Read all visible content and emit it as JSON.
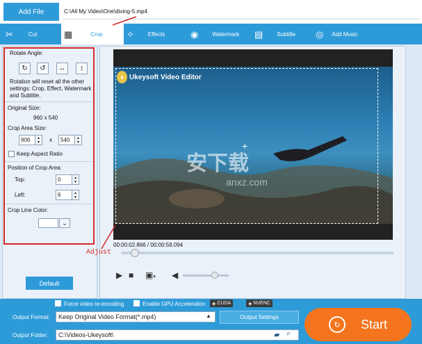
{
  "topbar": {
    "add_file": "Add File",
    "file_path": "C:\\All My Video\\One\\diving-5.mp4"
  },
  "tabs": [
    {
      "label": "Cut",
      "icon": "scissors-icon",
      "glyph": "✂",
      "active": false
    },
    {
      "label": "Crop",
      "icon": "crop-icon",
      "glyph": "▦",
      "active": true
    },
    {
      "label": "Effects",
      "icon": "effects-icon",
      "glyph": "✧",
      "active": false
    },
    {
      "label": "Watermark",
      "icon": "watermark-icon",
      "glyph": "◉",
      "active": false
    },
    {
      "label": "Subtitle",
      "icon": "subtitle-icon",
      "glyph": "▤",
      "active": false
    },
    {
      "label": "Add Music",
      "icon": "music-icon",
      "glyph": "◎",
      "active": false
    }
  ],
  "crop": {
    "rotate_label": "Rotate Angle:",
    "rotate_note": "Rotation will reset all the other settings: Crop, Effect, Watermark and Subtitle.",
    "original_label": "Original Size:",
    "original_value": "960 x 540",
    "area_label": "Crop Area Size:",
    "area_w": "906",
    "area_x": "x",
    "area_h": "540",
    "keep_ratio": "Keep Aspect Ratio",
    "position_label": "Position of Crop Area:",
    "top_label": "Top:",
    "top_value": "0",
    "left_label": "Left:",
    "left_value": "6",
    "color_label": "Crop Line Color:",
    "default_btn": "Default"
  },
  "player": {
    "video_title": "Ukeysoft Video Editor",
    "watermark_text": "安下载",
    "watermark_url": "anxz.com",
    "timecode": "00:00:02.866 / 00:00:59.094",
    "adjust_annotation": "Adjust",
    "progress": 0.05,
    "volume": 0.7
  },
  "bottom": {
    "force_reencode": "Force video re-encoding",
    "gpu": "Enable GPU Acceleration",
    "cuda": "CUDA",
    "nvenc": "NVENC",
    "output_format_label": "Output Format:",
    "output_format_value": "Keep Original Video Format(*.mp4)",
    "output_settings": "Output Settings",
    "output_folder_label": "Output Folder:",
    "output_folder_value": "C:\\Videos-Ukeysoft\\",
    "start": "Start"
  },
  "colors": {
    "accent": "#2e9bd9",
    "start": "#f4751e",
    "annotation": "#d42a2a"
  }
}
